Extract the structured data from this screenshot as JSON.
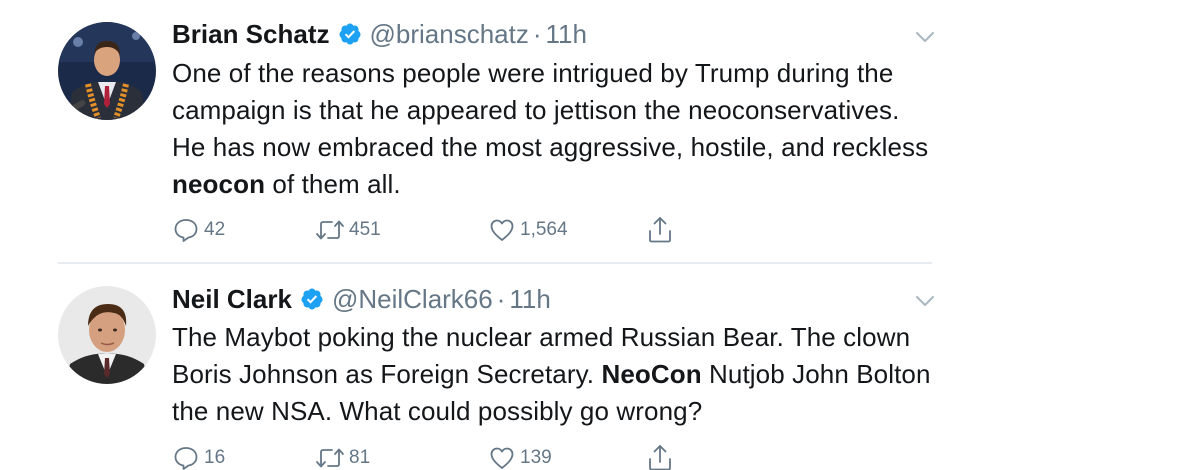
{
  "tweets": [
    {
      "name": "Brian Schatz",
      "handle": "@brianschatz",
      "separator": "·",
      "time": "11h",
      "text_segments": [
        {
          "text": "One of the reasons people were intrigued by Trump during the campaign is that he appeared to jettison the neoconservatives. He has now embraced the most aggressive, hostile, and reckless "
        },
        {
          "text": "neocon",
          "bold": true
        },
        {
          "text": " of them all."
        }
      ],
      "stats": {
        "replies": "42",
        "retweets": "451",
        "likes": "1,564"
      }
    },
    {
      "name": "Neil Clark",
      "handle": "@NeilClark66",
      "separator": "·",
      "time": "11h",
      "text_segments": [
        {
          "text": "The Maybot poking the nuclear armed Russian Bear. The clown Boris Johnson as Foreign Secretary. "
        },
        {
          "text": "NeoCon",
          "bold": true
        },
        {
          "text": " Nutjob John Bolton the new NSA. What could possibly go wrong?"
        }
      ],
      "stats": {
        "replies": "16",
        "retweets": "81",
        "likes": "139"
      }
    }
  ],
  "icons": {
    "verified": "verified-badge-icon",
    "caret": "chevron-down-icon",
    "reply": "reply-icon",
    "retweet": "retweet-icon",
    "like": "heart-icon",
    "share": "share-icon"
  },
  "colors": {
    "verified": "#1da1f2",
    "muted": "#657786",
    "text": "#14171a",
    "divider": "#e6ecf0"
  }
}
